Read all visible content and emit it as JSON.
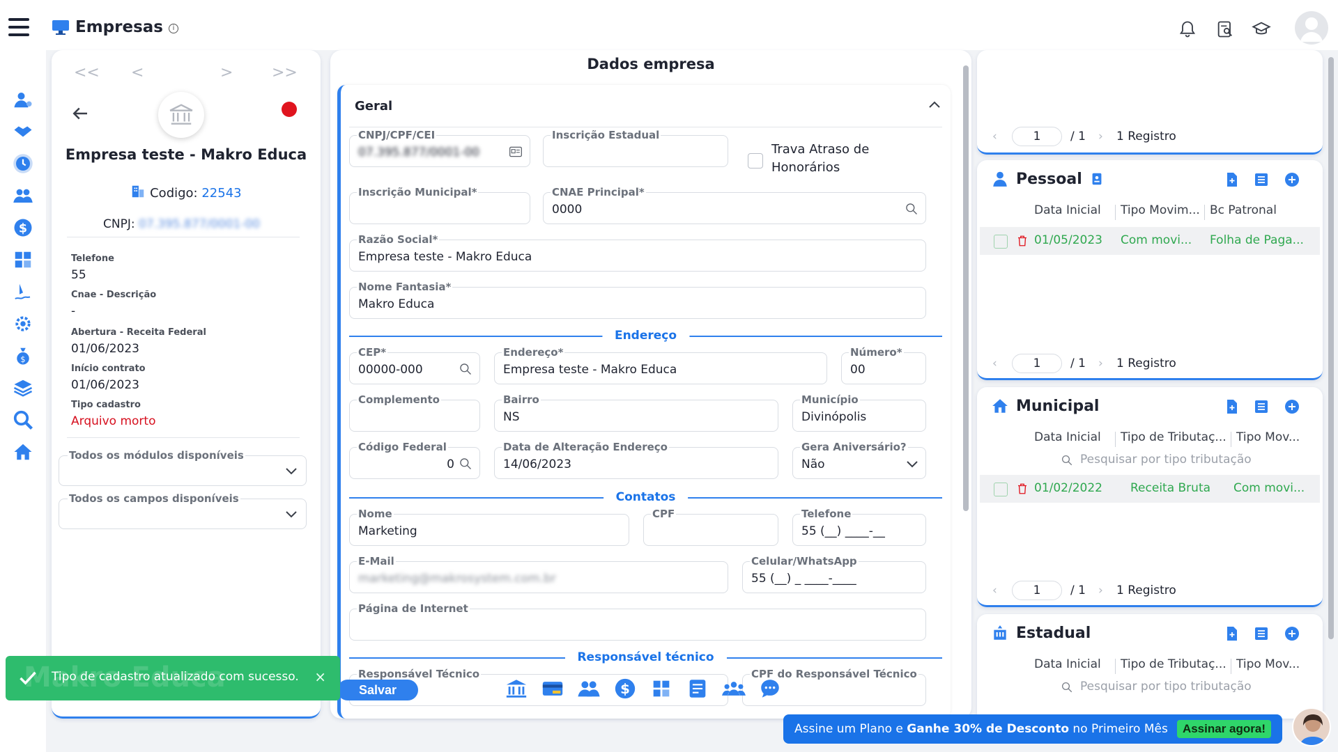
{
  "header": {
    "title": "Empresas",
    "info_mark": "i",
    "icons": [
      "bell-icon",
      "document-search-icon",
      "graduation-cap-icon",
      "user-avatar"
    ]
  },
  "rail": {
    "icons": [
      "user-settings-icon",
      "handshake-icon",
      "clock-icon",
      "users-icon",
      "dollar-icon",
      "calculator-icon",
      "signature-icon",
      "gear-network-icon",
      "money-bag-icon",
      "layers-icon",
      "search-icon",
      "home-icon"
    ]
  },
  "left": {
    "nav": [
      "<<",
      "<",
      ">",
      ">>"
    ],
    "company_name": "Empresa teste - Makro Educa",
    "codigo_label": "Codigo:",
    "codigo_value": "22543",
    "cnpj_label": "CNPJ:",
    "cnpj_value": "07.395.877/0001-00",
    "fields": [
      {
        "label": "Telefone",
        "value": "55"
      },
      {
        "label": "Cnae - Descrição",
        "value": "-"
      },
      {
        "label": "Abertura - Receita Federal",
        "value": "01/06/2023"
      },
      {
        "label": "Início contrato",
        "value": "01/06/2023"
      },
      {
        "label": "Tipo cadastro",
        "value": "Arquivo morto"
      }
    ],
    "dropdowns": [
      "Todos os módulos disponíveis",
      "Todos os campos disponíveis"
    ]
  },
  "mid": {
    "title": "Dados empresa",
    "section_geral": "Geral",
    "cnpj": {
      "label": "CNPJ/CPF/CEI",
      "value": "07.395.877/0001-00"
    },
    "inscricao_estadual": {
      "label": "Inscrição Estadual",
      "value": ""
    },
    "trava": {
      "label": "Trava Atraso de Honorários"
    },
    "inscricao_municipal": {
      "label": "Inscrição Municipal*",
      "value": ""
    },
    "cnae": {
      "label": "CNAE Principal*",
      "value": "0000"
    },
    "razao_social": {
      "label": "Razão Social*",
      "value": "Empresa teste - Makro Educa"
    },
    "nome_fantasia": {
      "label": "Nome Fantasia*",
      "value": "Makro Educa"
    },
    "section_endereco": "Endereço",
    "cep": {
      "label": "CEP*",
      "value": "00000-000"
    },
    "endereco": {
      "label": "Endereço*",
      "value": "Empresa teste - Makro Educa"
    },
    "numero": {
      "label": "Número*",
      "value": "00"
    },
    "complemento": {
      "label": "Complemento",
      "value": ""
    },
    "bairro": {
      "label": "Bairro",
      "value": "NS"
    },
    "municipio": {
      "label": "Município",
      "value": "Divinópolis"
    },
    "codigo_federal": {
      "label": "Código Federal",
      "value": "0"
    },
    "data_alteracao": {
      "label": "Data de Alteração Endereço",
      "value": "14/06/2023"
    },
    "gera_aniversario": {
      "label": "Gera Aniversário?",
      "value": "Não"
    },
    "section_contatos": "Contatos",
    "nome": {
      "label": "Nome",
      "value": "Marketing"
    },
    "cpf": {
      "label": "CPF",
      "value": ""
    },
    "telefone": {
      "label": "Telefone",
      "value": "55 (__) ____-__"
    },
    "email": {
      "label": "E-Mail",
      "value": "marketing@makrosystem.com.br"
    },
    "celular": {
      "label": "Celular/WhatsApp",
      "value": "55 (__) _ ____-____"
    },
    "pagina": {
      "label": "Página de Internet",
      "value": ""
    },
    "section_responsavel": "Responsável técnico",
    "responsavel": {
      "label": "Responsável Técnico"
    },
    "cpf_responsavel": {
      "label": "CPF do Responsável Técnico"
    },
    "save_label": "Salvar",
    "bottom_icons": [
      "bank-icon",
      "card-icon",
      "people-icon",
      "dollar-icon",
      "calculator-icon",
      "notes-icon",
      "team-icon",
      "chat-icon"
    ]
  },
  "right": {
    "top_pager": {
      "page": "1",
      "of": "/ 1",
      "count": "1 Registro"
    },
    "pessoal": {
      "title": "Pessoal",
      "cols": [
        "Data Inicial",
        "Tipo Movim...",
        "Bc Patronal"
      ],
      "row": [
        "01/05/2023",
        "Com movi...",
        "Folha de Paga..."
      ],
      "pager": {
        "page": "1",
        "of": "/ 1",
        "count": "1 Registro"
      }
    },
    "municipal": {
      "title": "Municipal",
      "cols": [
        "Data Inicial",
        "Tipo de Tributaç...",
        "Tipo Mov..."
      ],
      "search": "Pesquisar por tipo tributação",
      "row": [
        "01/02/2022",
        "Receita Bruta",
        "Com movi..."
      ],
      "pager": {
        "page": "1",
        "of": "/ 1",
        "count": "1 Registro"
      }
    },
    "estadual": {
      "title": "Estadual",
      "cols": [
        "Data Inicial",
        "Tipo de Tributaç...",
        "Tipo Mov..."
      ],
      "search": "Pesquisar por tipo tributação"
    }
  },
  "toast": {
    "message": "Tipo de cadastro atualizado com sucesso.",
    "close": "×",
    "watermark": "Makro Educa"
  },
  "banner": {
    "prefix": "Assine um Plano e ",
    "bold": "Ganhe 30% de Desconto",
    "suffix": " no Primeiro Mês",
    "cta": "Assinar agora!"
  },
  "colors": {
    "accent": "#2f80ed",
    "success": "#2ebc6d",
    "danger": "#e0141e",
    "row_text": "#2fa84f"
  }
}
